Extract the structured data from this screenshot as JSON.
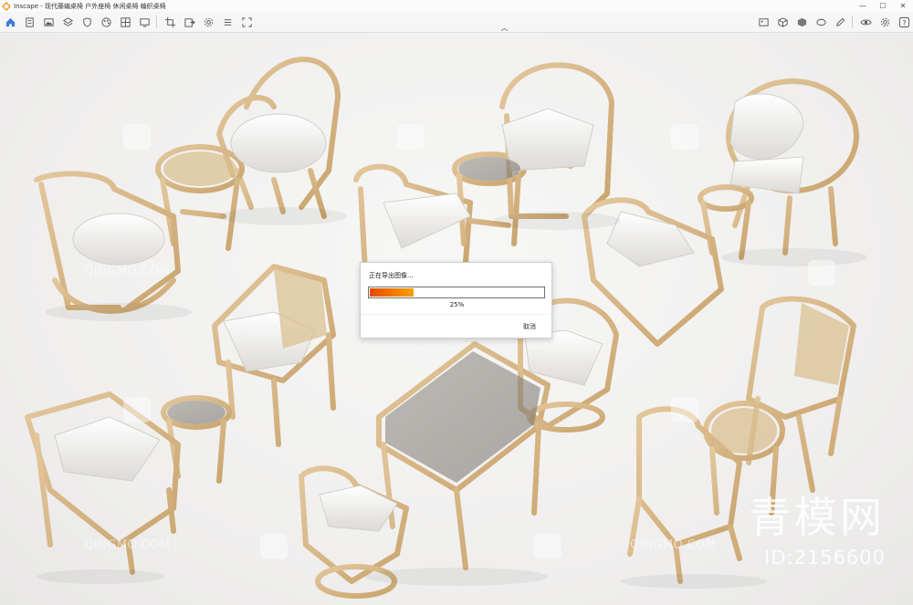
{
  "window": {
    "title": "Inscape - 现代藤编桌椅 户外座椅 休闲桌椅 编织桌椅",
    "controls": [
      "minimize-icon",
      "maximize-icon",
      "close-icon"
    ]
  },
  "toolbar": {
    "left_icons": [
      "home-icon",
      "document-icon",
      "image-icon",
      "layers-icon",
      "shield-icon",
      "color-palette-icon",
      "grid-icon",
      "fit-screen-icon",
      "crop-icon",
      "export-icon",
      "settings-icon",
      "list-icon",
      "expand-icon"
    ],
    "right_icons": [
      "image-icon",
      "cube-icon",
      "material-icon",
      "shape-icon",
      "edit-icon",
      "eye-icon",
      "gear-icon",
      "help-icon"
    ],
    "collapse_icon": "chevron-up-icon"
  },
  "canvas": {
    "watermarks": {
      "small_text": "QINGMO.COM",
      "brand": "青模网",
      "id": "ID:2156600"
    }
  },
  "dialog": {
    "message": "正在导出图像...",
    "progress": 0.25,
    "percent_label": "25%",
    "cancel_label": "取消",
    "accent_colors": [
      "#e64a00",
      "#f8a000"
    ]
  }
}
